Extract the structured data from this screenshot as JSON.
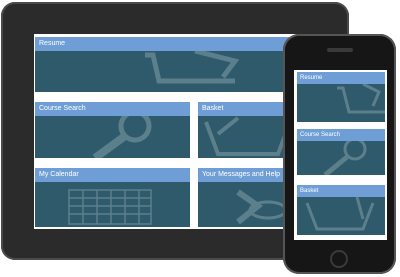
{
  "tablet": {
    "tiles": [
      {
        "label": "Resume",
        "icon": "cart-icon"
      },
      {
        "label": "Course Search",
        "icon": "magnifier-icon"
      },
      {
        "label": "Basket",
        "icon": "basket-icon"
      },
      {
        "label": "My Calendar",
        "icon": "calendar-icon"
      },
      {
        "label": "Your Messages and Help",
        "icon": "help-icon"
      }
    ]
  },
  "phone": {
    "tiles": [
      {
        "label": "Resume",
        "icon": "cart-icon"
      },
      {
        "label": "Course Search",
        "icon": "magnifier-icon"
      },
      {
        "label": "Basket",
        "icon": "basket-icon"
      }
    ]
  },
  "colors": {
    "tile_bg": "#2f5a6b",
    "tile_bar": "#6f9ed6",
    "device_frame": "#2b2b2b"
  }
}
